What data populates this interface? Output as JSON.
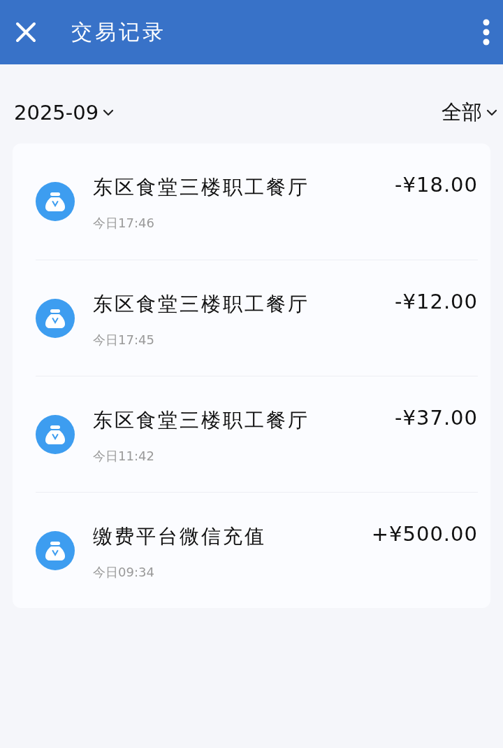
{
  "header": {
    "title": "交易记录"
  },
  "filters": {
    "month": "2025-09",
    "type": "全部"
  },
  "transactions": [
    {
      "name": "东区食堂三楼职工餐厅",
      "time": "今日17:46",
      "amount": "-¥18.00"
    },
    {
      "name": "东区食堂三楼职工餐厅",
      "time": "今日17:45",
      "amount": "-¥12.00"
    },
    {
      "name": "东区食堂三楼职工餐厅",
      "time": "今日11:42",
      "amount": "-¥37.00"
    },
    {
      "name": "缴费平台微信充值",
      "time": "今日09:34",
      "amount": "+¥500.00"
    }
  ]
}
